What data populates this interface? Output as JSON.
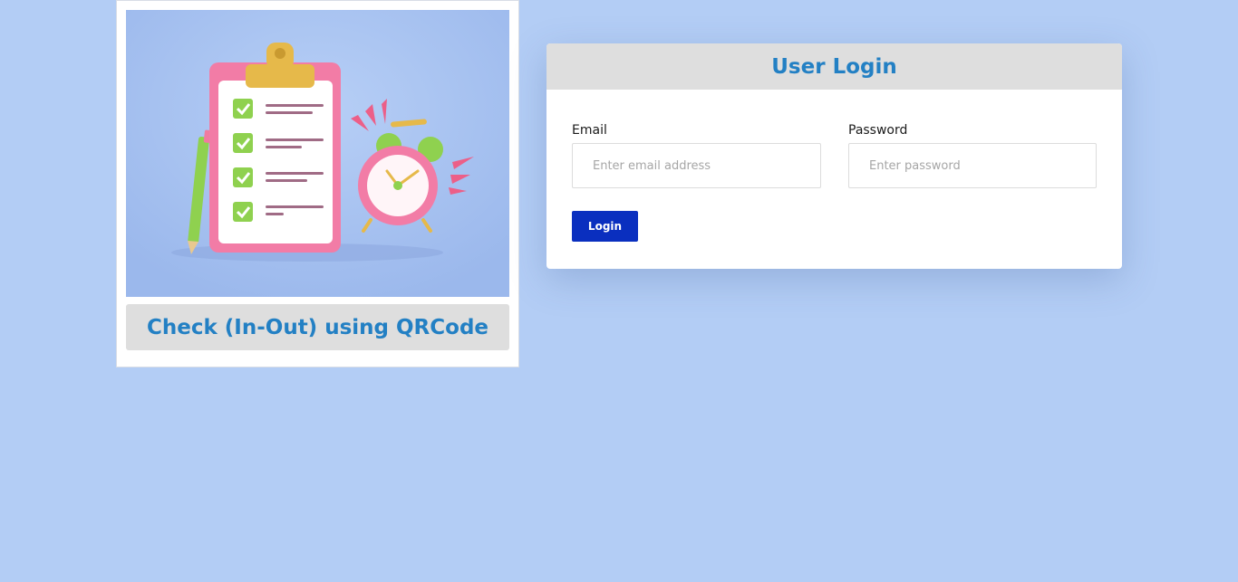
{
  "left_panel": {
    "caption": "Check (In-Out) using QRCode",
    "illustration_icon": "clipboard-checklist-alarm-clock-illustration"
  },
  "login": {
    "title": "User Login",
    "email_label": "Email",
    "email_placeholder": "Enter email address",
    "email_value": "",
    "password_label": "Password",
    "password_placeholder": "Enter password",
    "password_value": "",
    "button_label": "Login"
  },
  "colors": {
    "page_background": "#b3cdf5",
    "accent_text": "#2380c4",
    "header_background": "#dedede",
    "button_background": "#0a2fbf"
  }
}
